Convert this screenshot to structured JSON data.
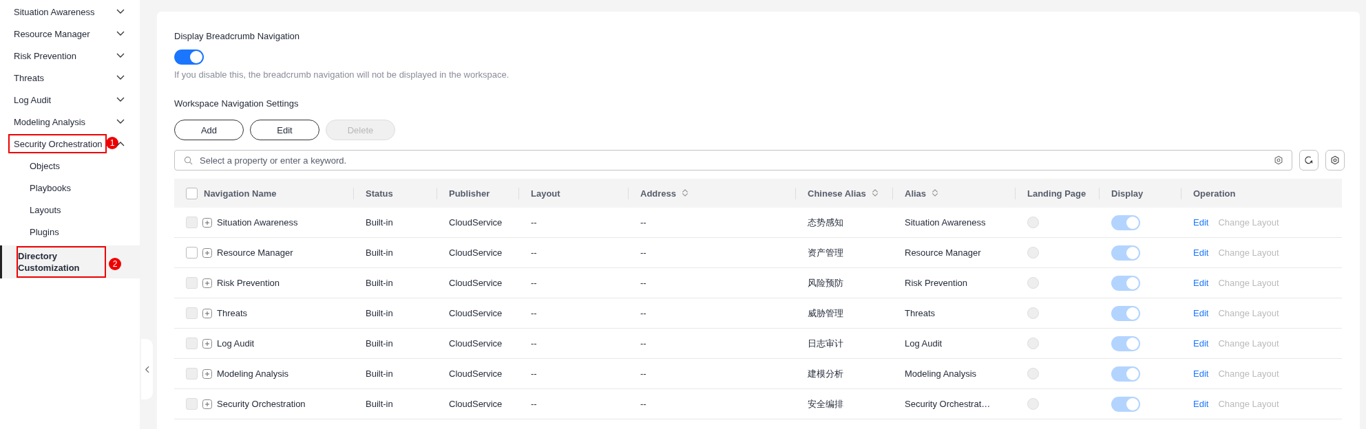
{
  "sidebar": {
    "items": [
      {
        "label": "Situation Awareness",
        "expanded": false,
        "selected": false
      },
      {
        "label": "Resource Manager",
        "expanded": false,
        "selected": false
      },
      {
        "label": "Risk Prevention",
        "expanded": false,
        "selected": false
      },
      {
        "label": "Threats",
        "expanded": false,
        "selected": false
      },
      {
        "label": "Log Audit",
        "expanded": false,
        "selected": false
      },
      {
        "label": "Modeling Analysis",
        "expanded": false,
        "selected": false
      },
      {
        "label": "Security Orchestration",
        "expanded": true,
        "selected": false,
        "annotation": "1",
        "children": [
          {
            "label": "Objects",
            "selected": false
          },
          {
            "label": "Playbooks",
            "selected": false
          },
          {
            "label": "Layouts",
            "selected": false
          },
          {
            "label": "Plugins",
            "selected": false
          },
          {
            "label": "Directory Customization",
            "selected": true,
            "annotation": "2"
          }
        ]
      }
    ]
  },
  "breadcrumb_setting": {
    "label": "Display Breadcrumb Navigation",
    "on": true,
    "hint": "If you disable this, the breadcrumb navigation will not be displayed in the workspace."
  },
  "navigation_settings": {
    "title": "Workspace Navigation Settings",
    "buttons": [
      {
        "label": "Add",
        "disabled": false
      },
      {
        "label": "Edit",
        "disabled": false
      },
      {
        "label": "Delete",
        "disabled": true
      }
    ],
    "search": {
      "placeholder": "Select a property or enter a keyword."
    }
  },
  "table": {
    "columns": [
      {
        "label": "Navigation Name",
        "sortable": false
      },
      {
        "label": "Status",
        "sortable": false
      },
      {
        "label": "Publisher",
        "sortable": false
      },
      {
        "label": "Layout",
        "sortable": false
      },
      {
        "label": "Address",
        "sortable": true
      },
      {
        "label": "Chinese Alias",
        "sortable": true
      },
      {
        "label": "Alias",
        "sortable": true
      },
      {
        "label": "Landing Page",
        "sortable": false
      },
      {
        "label": "Display",
        "sortable": false
      },
      {
        "label": "Operation",
        "sortable": false
      }
    ],
    "header_checked": false,
    "rows": [
      {
        "name": "Situation Awareness",
        "status": "Built-in",
        "publisher": "CloudService",
        "layout": "--",
        "address": "--",
        "chinese_alias": "态势感知",
        "alias": "Situation Awareness",
        "checkbox_disabled": true,
        "landing_page": false,
        "display_on": true,
        "actions": [
          {
            "label": "Edit",
            "disabled": false
          },
          {
            "label": "Change Layout",
            "disabled": true
          }
        ]
      },
      {
        "name": "Resource Manager",
        "status": "Built-in",
        "publisher": "CloudService",
        "layout": "--",
        "address": "--",
        "chinese_alias": "资产管理",
        "alias": "Resource Manager",
        "checkbox_disabled": false,
        "landing_page": false,
        "display_on": true,
        "actions": [
          {
            "label": "Edit",
            "disabled": false
          },
          {
            "label": "Change Layout",
            "disabled": true
          }
        ]
      },
      {
        "name": "Risk Prevention",
        "status": "Built-in",
        "publisher": "CloudService",
        "layout": "--",
        "address": "--",
        "chinese_alias": "风险预防",
        "alias": "Risk Prevention",
        "checkbox_disabled": true,
        "landing_page": false,
        "display_on": true,
        "actions": [
          {
            "label": "Edit",
            "disabled": false
          },
          {
            "label": "Change Layout",
            "disabled": true
          }
        ]
      },
      {
        "name": "Threats",
        "status": "Built-in",
        "publisher": "CloudService",
        "layout": "--",
        "address": "--",
        "chinese_alias": "威胁管理",
        "alias": "Threats",
        "checkbox_disabled": true,
        "landing_page": false,
        "display_on": true,
        "actions": [
          {
            "label": "Edit",
            "disabled": false
          },
          {
            "label": "Change Layout",
            "disabled": true
          }
        ]
      },
      {
        "name": "Log Audit",
        "status": "Built-in",
        "publisher": "CloudService",
        "layout": "--",
        "address": "--",
        "chinese_alias": "日志审计",
        "alias": "Log Audit",
        "checkbox_disabled": true,
        "landing_page": false,
        "display_on": true,
        "actions": [
          {
            "label": "Edit",
            "disabled": false
          },
          {
            "label": "Change Layout",
            "disabled": true
          }
        ]
      },
      {
        "name": "Modeling Analysis",
        "status": "Built-in",
        "publisher": "CloudService",
        "layout": "--",
        "address": "--",
        "chinese_alias": "建模分析",
        "alias": "Modeling Analysis",
        "checkbox_disabled": true,
        "landing_page": false,
        "display_on": true,
        "actions": [
          {
            "label": "Edit",
            "disabled": false
          },
          {
            "label": "Change Layout",
            "disabled": true
          }
        ]
      },
      {
        "name": "Security Orchestration",
        "status": "Built-in",
        "publisher": "CloudService",
        "layout": "--",
        "address": "--",
        "chinese_alias": "安全编排",
        "alias": "Security Orchestrat…",
        "checkbox_disabled": true,
        "landing_page": false,
        "display_on": true,
        "actions": [
          {
            "label": "Edit",
            "disabled": false
          },
          {
            "label": "Change Layout",
            "disabled": true
          }
        ]
      }
    ]
  }
}
